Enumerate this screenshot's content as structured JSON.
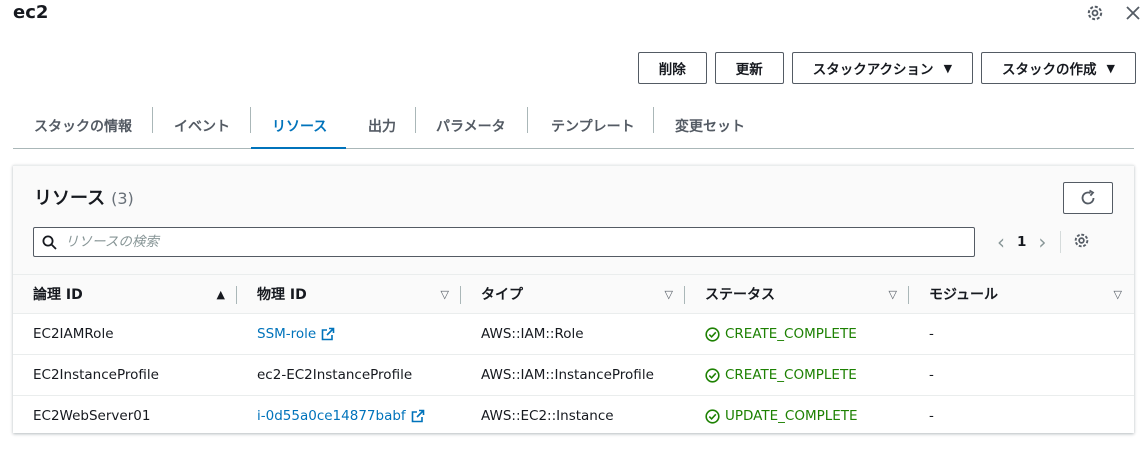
{
  "stack": {
    "title": "ec2"
  },
  "toolbar": {
    "delete_label": "削除",
    "update_label": "更新",
    "stack_actions_label": "スタックアクション",
    "create_stack_label": "スタックの作成"
  },
  "tabs": [
    {
      "label": "スタックの情報",
      "active": false
    },
    {
      "label": "イベント",
      "active": false
    },
    {
      "label": "リソース",
      "active": true
    },
    {
      "label": "出力",
      "active": false
    },
    {
      "label": "パラメータ",
      "active": false
    },
    {
      "label": "テンプレート",
      "active": false
    },
    {
      "label": "変更セット",
      "active": false
    }
  ],
  "resources": {
    "title": "リソース",
    "count": "(3)",
    "search_placeholder": "リソースの検索",
    "page": "1",
    "columns": [
      "論理 ID",
      "物理 ID",
      "タイプ",
      "ステータス",
      "モジュール"
    ],
    "rows": [
      {
        "logical_id": "EC2IAMRole",
        "physical_id": "SSM-role",
        "physical_link": true,
        "type": "AWS::IAM::Role",
        "status": "CREATE_COMPLETE",
        "module": "-"
      },
      {
        "logical_id": "EC2InstanceProfile",
        "physical_id": "ec2-EC2InstanceProfile",
        "physical_link": false,
        "type": "AWS::IAM::InstanceProfile",
        "status": "CREATE_COMPLETE",
        "module": "-"
      },
      {
        "logical_id": "EC2WebServer01",
        "physical_id": "i-0d55a0ce14877babf",
        "physical_link": true,
        "type": "AWS::EC2::Instance",
        "status": "UPDATE_COMPLETE",
        "module": "-"
      }
    ]
  },
  "colors": {
    "accent": "#0073bb",
    "success": "#1d8102",
    "border": "#aab7b8"
  },
  "icons": [
    "gear-icon",
    "close-icon",
    "caret-down-icon",
    "refresh-icon",
    "search-icon",
    "chevron-left-icon",
    "chevron-right-icon",
    "external-link-icon",
    "status-success-icon",
    "sort-ascending-icon",
    "sort-icon"
  ]
}
